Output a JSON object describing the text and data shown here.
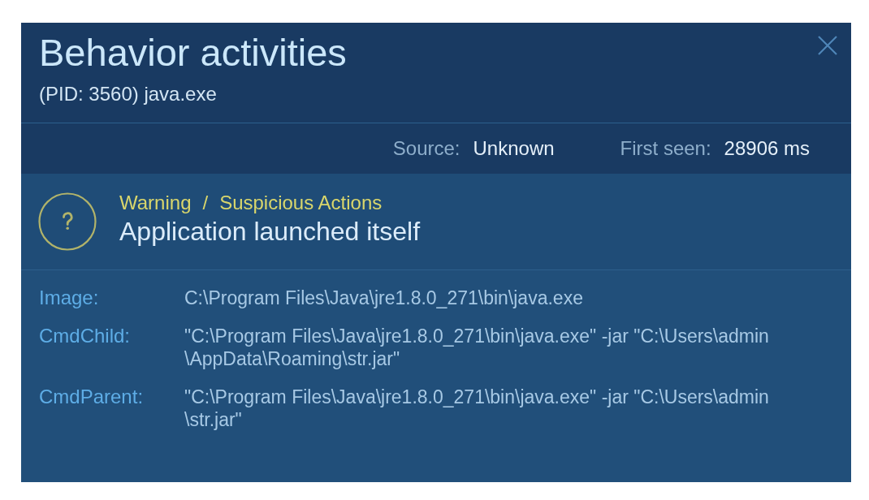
{
  "dialog": {
    "title": "Behavior activities",
    "subtitle": "(PID: 3560) java.exe",
    "meta": [
      {
        "label": "Source:",
        "value": "Unknown"
      },
      {
        "label": "First seen:",
        "value": "28906 ms"
      }
    ],
    "event": {
      "severity": "Warning",
      "separator": "/",
      "category": "Suspicious Actions",
      "title": "Application launched itself"
    },
    "details": [
      {
        "label": "Image:",
        "value": "C:\\Program Files\\Java\\jre1.8.0_271\\bin\\java.exe"
      },
      {
        "label": "CmdChild:",
        "value": "\"C:\\Program Files\\Java\\jre1.8.0_271\\bin\\java.exe\" -jar \"C:\\Users\\admin\\AppData\\Roaming\\str.jar\""
      },
      {
        "label": "CmdParent:",
        "value": "\"C:\\Program Files\\Java\\jre1.8.0_271\\bin\\java.exe\" -jar \"C:\\Users\\admin\\str.jar\""
      }
    ]
  }
}
